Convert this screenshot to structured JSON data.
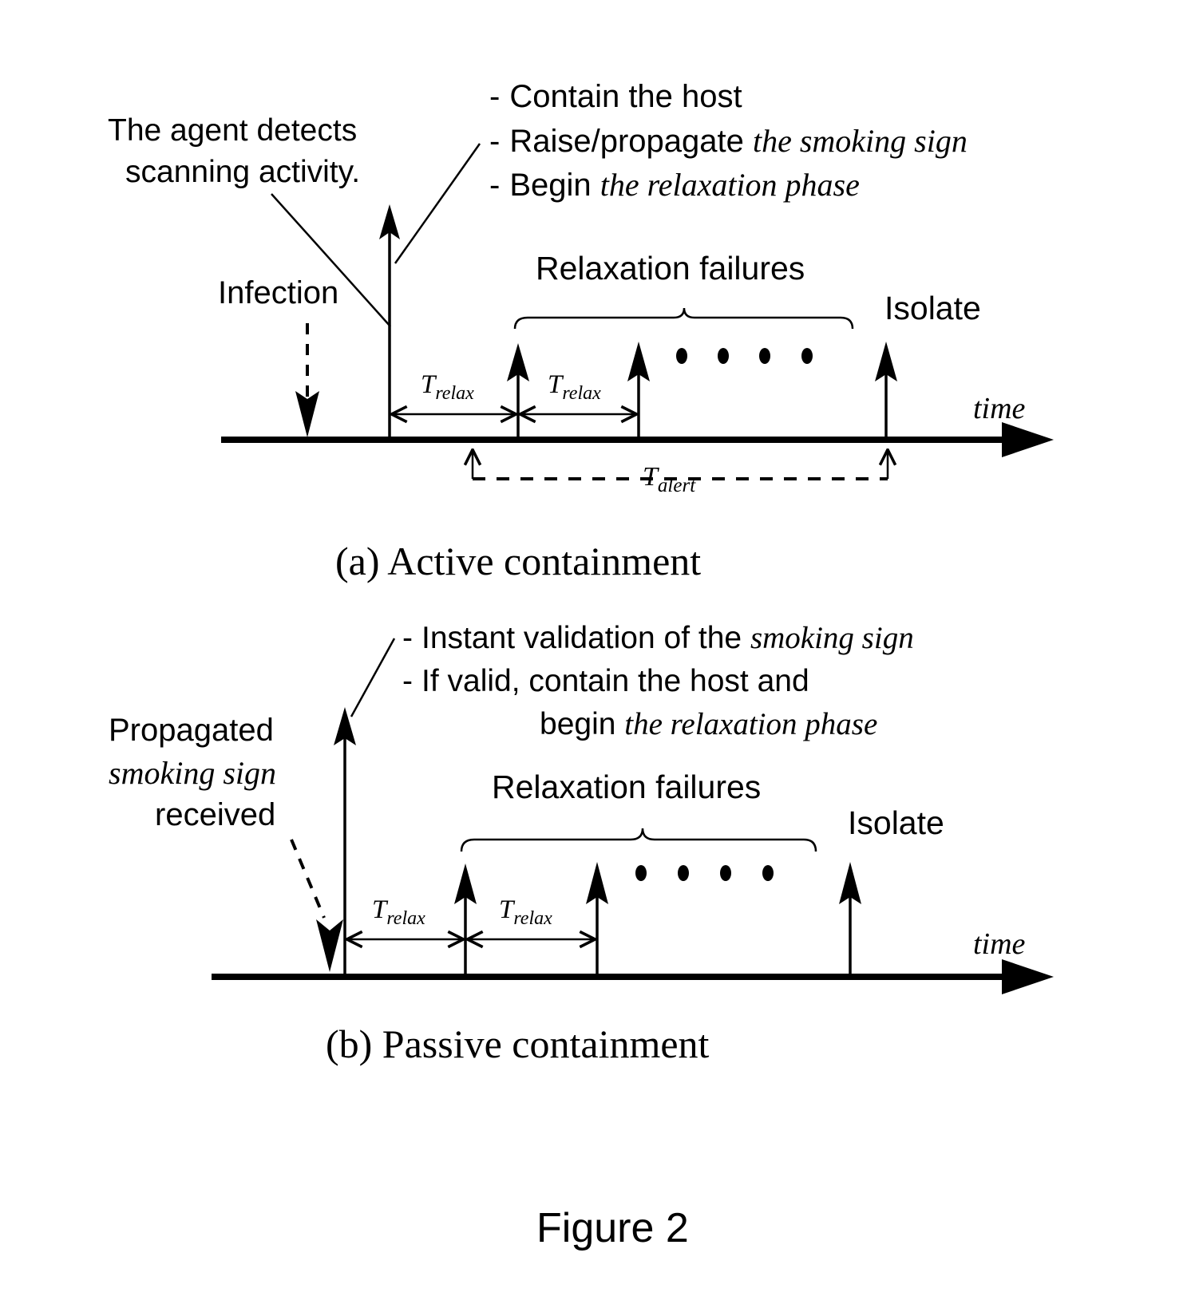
{
  "figure": {
    "number_label": "Figure 2"
  },
  "panel_a": {
    "caption": "(a)  Active containment",
    "annotation_left": {
      "line1": "The agent detects",
      "line2": "scanning activity."
    },
    "bullets": [
      {
        "dash": "-",
        "plain": "Contain the host",
        "italic": ""
      },
      {
        "dash": "-",
        "plain": "Raise/propagate ",
        "italic": "the smoking sign"
      },
      {
        "dash": "-",
        "plain": "Begin ",
        "italic": "the relaxation phase"
      }
    ],
    "infection_label": "Infection",
    "relaxation_failures_label": "Relaxation failures",
    "isolate_label": "Isolate",
    "time_axis_label": "time",
    "relax_interval_1": {
      "base": "T",
      "sub": "relax"
    },
    "relax_interval_2": {
      "base": "T",
      "sub": "relax"
    },
    "alert_interval": {
      "base": "T",
      "sub": "alert"
    },
    "ellipsis_dots": 4
  },
  "panel_b": {
    "caption": "(b)  Passive containment",
    "annotation_left": {
      "line1": "Propagated",
      "line2_italic": "smoking sign",
      "line3": "received"
    },
    "bullets": [
      {
        "dash": "-",
        "plain": "Instant validation of the ",
        "italic": "smoking sign"
      },
      {
        "dash": "-",
        "plain": "If valid, contain the host and",
        "italic": ""
      },
      {
        "dash": "",
        "plain": "begin ",
        "italic": "the relaxation phase"
      }
    ],
    "relaxation_failures_label": "Relaxation failures",
    "isolate_label": "Isolate",
    "time_axis_label": "time",
    "relax_interval_1": {
      "base": "T",
      "sub": "relax"
    },
    "relax_interval_2": {
      "base": "T",
      "sub": "relax"
    },
    "ellipsis_dots": 4
  },
  "colors": {
    "ink": "#000000",
    "background": "#ffffff"
  }
}
